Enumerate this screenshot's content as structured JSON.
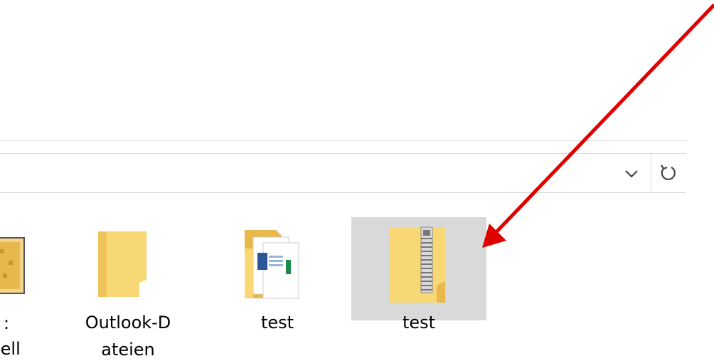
{
  "address_bar": {
    "dropdown_icon": "chevron-down-icon",
    "refresh_icon": "refresh-icon"
  },
  "files": [
    {
      "label_line1": ":",
      "label_line2": "ıell",
      "icon": "image-file-icon",
      "selected": false
    },
    {
      "label_line1": "Outlook-D",
      "label_line2": "ateien",
      "icon": "folder-icon",
      "selected": false
    },
    {
      "label_line1": "test",
      "label_line2": "",
      "icon": "folder-with-documents-icon",
      "selected": false
    },
    {
      "label_line1": "test",
      "label_line2": "",
      "icon": "zip-folder-icon",
      "selected": true
    }
  ],
  "colors": {
    "folder": "#f8d775",
    "folder_dark": "#e8b84b",
    "selection": "#d9d9d9",
    "annotation_arrow": "#e00000"
  }
}
